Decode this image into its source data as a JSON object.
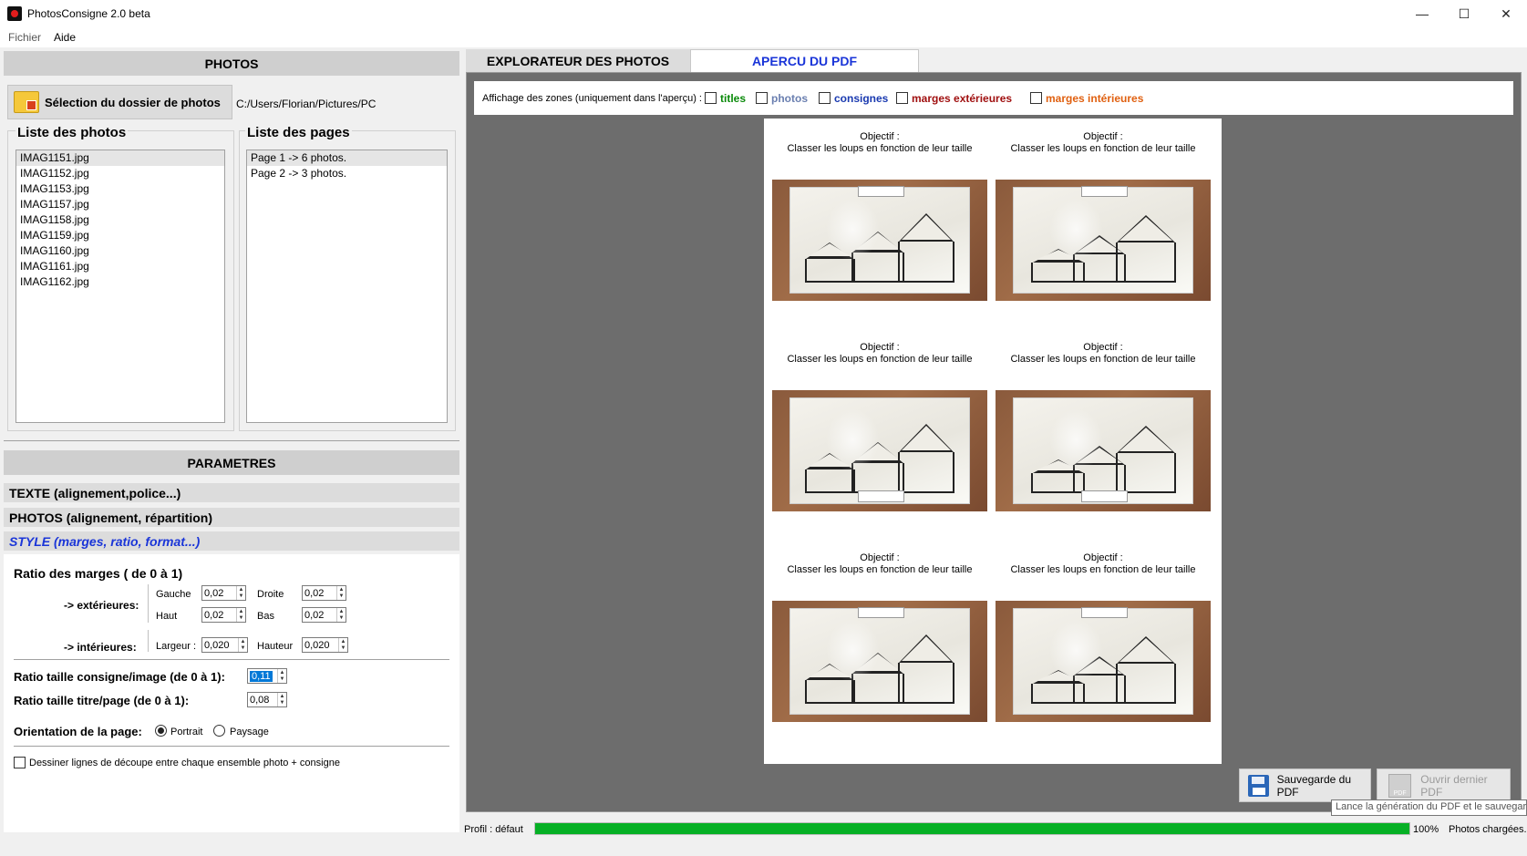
{
  "window": {
    "title": "PhotosConsigne 2.0 beta",
    "minimize": "—",
    "maximize": "☐",
    "close": "✕"
  },
  "menu": {
    "file": "Fichier",
    "help": "Aide"
  },
  "photos_panel": {
    "header": "PHOTOS",
    "select_button": "Sélection du dossier de photos",
    "folder_path": "C:/Users/Florian/Pictures/PC",
    "photos_list_title": "Liste des photos",
    "pages_list_title": "Liste des pages",
    "photos": [
      "IMAG1151.jpg",
      "IMAG1152.jpg",
      "IMAG1153.jpg",
      "IMAG1157.jpg",
      "IMAG1158.jpg",
      "IMAG1159.jpg",
      "IMAG1160.jpg",
      "IMAG1161.jpg",
      "IMAG1162.jpg"
    ],
    "pages": [
      "Page 1 -> 6 photos.",
      "Page 2 -> 3 photos."
    ]
  },
  "params": {
    "header": "PARAMETRES",
    "section_text": "TEXTE (alignement,police...)",
    "section_photos": "PHOTOS (alignement, répartition)",
    "section_style": "STYLE (marges, ratio, format...)",
    "margins_title": "Ratio des marges ( de 0 à 1)",
    "exterior_label": "-> extérieures:",
    "interior_label": "-> intérieures:",
    "left_label": "Gauche",
    "left_value": "0,02",
    "right_label": "Droite",
    "right_value": "0,02",
    "top_label": "Haut",
    "top_value": "0,02",
    "bottom_label": "Bas",
    "bottom_value": "0,02",
    "width_label": "Largeur :",
    "width_value": "0,020",
    "height_label": "Hauteur",
    "height_value": "0,020",
    "ratio_consigne_label": "Ratio taille consigne/image (de 0 à 1):",
    "ratio_consigne_value": "0,11",
    "ratio_title_label": "Ratio taille titre/page (de 0 à 1):",
    "ratio_title_value": "0,08",
    "orientation_label": "Orientation de la page:",
    "portrait_label": "Portrait",
    "landscape_label": "Paysage",
    "cut_lines_label": "Dessiner lignes de découpe entre chaque ensemble photo + consigne"
  },
  "tabs": {
    "explorer": "EXPLORATEUR DES PHOTOS",
    "preview": "APERCU DU PDF"
  },
  "zones": {
    "label": "Affichage des zones (uniquement dans l'aperçu) :",
    "items": [
      {
        "label": "titles",
        "color": "#0a8a0a"
      },
      {
        "label": "photos",
        "color": "#6a7fb0"
      },
      {
        "label": "consignes",
        "color": "#1a3ab0"
      },
      {
        "label": "marges extérieures",
        "color": "#a01010"
      },
      {
        "label": "marges intérieures",
        "color": "#e06010"
      }
    ]
  },
  "preview": {
    "captions": [
      {
        "title": "Objectif :",
        "text": "Classer les loups en fonction de leur taille"
      },
      {
        "title": "Objectif :",
        "text": "Classer les loups en fonction de leur taille"
      },
      {
        "title": "Objectif :",
        "text": "Classer les loups en fonction de leur taille"
      },
      {
        "title": "Objectif :",
        "text": "Classer les loups en fonction de leur taille"
      },
      {
        "title": "Objectif :",
        "text": "Classer les loups en fonction de leur taille"
      },
      {
        "title": "Objectif :",
        "text": "Classer les loups en fonction de leur taille"
      }
    ]
  },
  "actions": {
    "save_pdf": "Sauvegarde du PDF",
    "open_last_pdf": "Ouvrir dernier PDF",
    "tooltip": "Lance la génération du PDF et le sauvegarde"
  },
  "status": {
    "profile": "Profil :  défaut",
    "progress": 100,
    "progress_text": "100%",
    "message": "Photos chargées."
  }
}
